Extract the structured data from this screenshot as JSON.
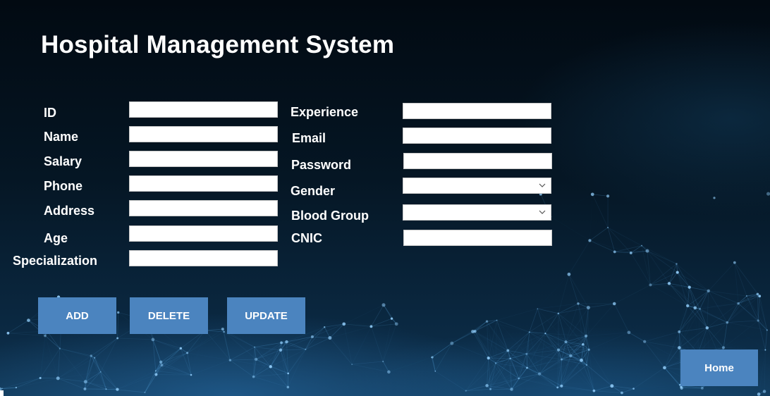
{
  "title": "Hospital Management System",
  "left_fields": [
    {
      "label": "ID",
      "value": ""
    },
    {
      "label": "Name",
      "value": ""
    },
    {
      "label": "Salary",
      "value": ""
    },
    {
      "label": "Phone",
      "value": ""
    },
    {
      "label": "Address",
      "value": ""
    },
    {
      "label": "Age",
      "value": ""
    },
    {
      "label": "Specialization",
      "value": ""
    }
  ],
  "right_fields": [
    {
      "label": "Experience",
      "value": ""
    },
    {
      "label": "Email",
      "value": ""
    },
    {
      "label": "Password",
      "value": ""
    },
    {
      "label": "Gender",
      "value": ""
    },
    {
      "label": "Blood Group",
      "value": ""
    },
    {
      "label": "CNIC",
      "value": ""
    }
  ],
  "buttons": {
    "add": "ADD",
    "delete": "DELETE",
    "update": "UPDATE",
    "home": "Home"
  },
  "colors": {
    "button": "#4b84bf",
    "background_dark": "#020a12",
    "background_glow": "#1e5f96"
  },
  "icons": {
    "dropdown": "chevron-down-icon"
  }
}
